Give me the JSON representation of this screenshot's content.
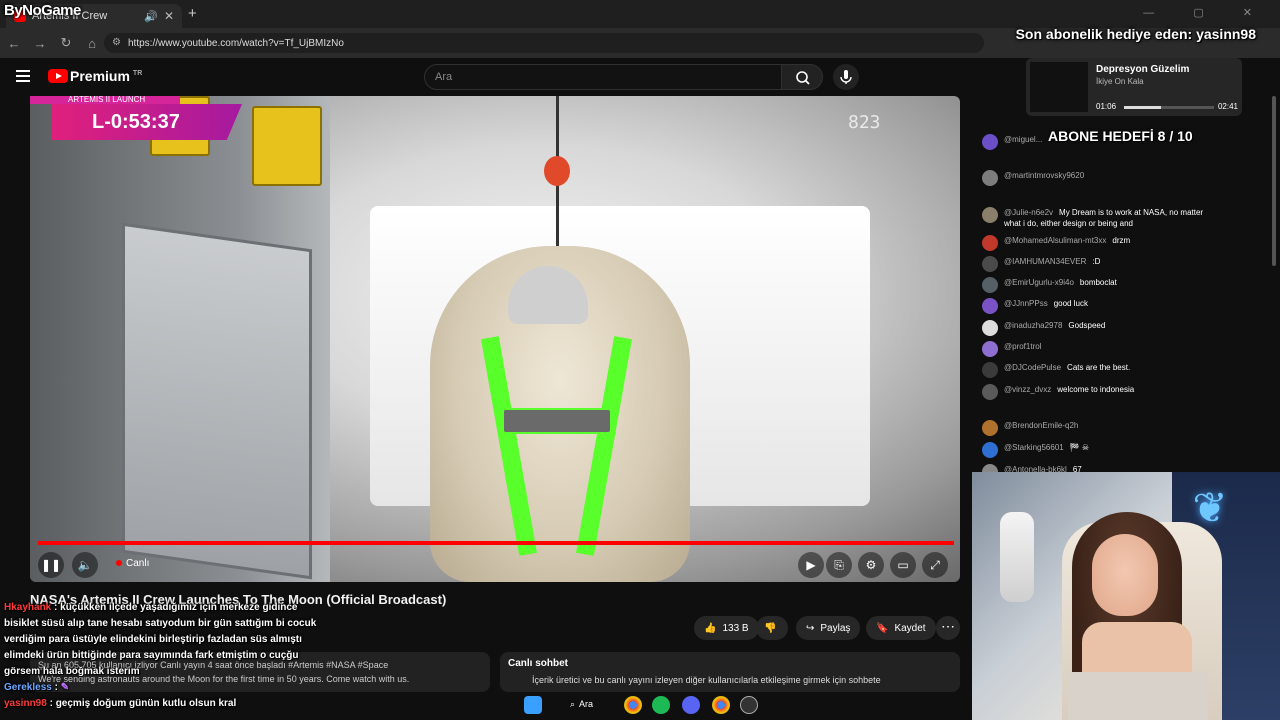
{
  "browser": {
    "brand": "ByNoGame",
    "tab_title": "Artemis II Crew",
    "url": "https://www.youtube.com/watch?v=Tf_UjBMIzNo"
  },
  "overlay": {
    "sub_gift": "Son abonelik hediye eden: yasinn98",
    "goal": "ABONE HEDEFİ 8 / 10",
    "music": {
      "song": "Depresyon Güzelim",
      "artist": "İkiye On Kala",
      "elapsed": "01:06",
      "total": "02:41",
      "progress": 0.41
    },
    "chat": [
      {
        "name": "Hkayhank",
        "text": ": küçükken ilçede yaşadığımız için merkeze gidince bisiklet süsü alıp tane hesabı satıyodum bir gün sattığım bi cocuk verdiğim para üstüyle elindekini birleştirip fazladan süs almıştı elimdeki ürün bittiğinde para sayımında fark etmiştim o cuçğu görsem hala boğmak isterim"
      },
      {
        "name": "Gerekless",
        "text": ":"
      },
      {
        "name": "yasinn98",
        "text": ": geçmiş doğum günün kutlu olsun kral"
      }
    ]
  },
  "youtube": {
    "logo_text": "Premium",
    "logo_sup": "TR",
    "search_placeholder": "Ara",
    "video": {
      "countdown_header": "ARTEMIS II LAUNCH",
      "countdown": "L-0:53:37",
      "cam_id": "823",
      "live_label": "Canlı",
      "progress": 1.0
    },
    "title": "NASA's Artemis II Crew Launches To The Moon (Official Broadcast)",
    "actions": {
      "likes": "133 B",
      "share": "Paylaş",
      "save": "Kaydet"
    },
    "description": {
      "stats": "Şu an 605.705 kullanıcı izliyor  Canlı yayın 4 saat önce başladı  #Artemis #NASA #Space",
      "text": "We're sending astronauts around the Moon for the first time in 50 years. Come watch with us."
    },
    "chat_promo": {
      "heading": "Canlı sohbet",
      "text": "İçerik üretici ve bu canlı yayını izleyen diğer kullanıcılarla etkileşime girmek için sohbete"
    },
    "live_chat": [
      {
        "name": "@miguel...",
        "text": "",
        "color": "#6a4fc8"
      },
      {
        "name": "@martintmrovsky9620",
        "text": "",
        "color": "#7d7d7d"
      },
      {
        "name": "@Julie-n6e2v",
        "text": "My Dream is to work at NASA, no matter what i do, either design or being and",
        "color": "#8a7f6a"
      },
      {
        "name": "@MohamedAlsuliman-mt3xx",
        "text": "drzm",
        "color": "#c0392b"
      },
      {
        "name": "@IAMHUMAN34EVER",
        "text": ":D",
        "color": "#4a4a4a"
      },
      {
        "name": "@EmirUgurlu-x9i4o",
        "text": "bomboclat",
        "color": "#555f66"
      },
      {
        "name": "@JJnnPPss",
        "text": "good luck",
        "color": "#7b52c6"
      },
      {
        "name": "@inaduzha2978",
        "text": "Godspeed",
        "color": "#dcdcdc"
      },
      {
        "name": "@prof1trol",
        "text": "",
        "color": "#8e6fd1"
      },
      {
        "name": "@DJCodePulse",
        "text": "Cats are the best.",
        "color": "#3b3b3b"
      },
      {
        "name": "@vinzz_dvxz",
        "text": "welcome to indonesia",
        "color": "#5a5a5a"
      },
      {
        "name": "@BrendonEmile-q2h",
        "text": "",
        "color": "#b0712f"
      },
      {
        "name": "@Starking56601",
        "text": "🏁 ☠",
        "color": "#2f6fd1"
      },
      {
        "name": "@Antonella-bk6kl",
        "text": "67",
        "color": "#888888"
      }
    ]
  },
  "taskbar": {
    "search_label": "Ara"
  },
  "colors": {
    "accent": "#ff0000",
    "countdown": "#e0207c",
    "harness": "#58ff2a"
  }
}
